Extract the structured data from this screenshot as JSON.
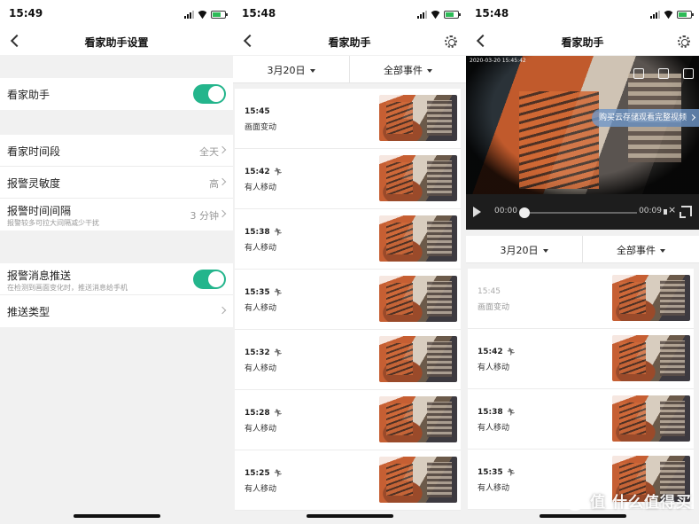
{
  "panels": [
    {
      "status_time": "15:49",
      "title": "看家助手设置"
    },
    {
      "status_time": "15:48",
      "title": "看家助手"
    },
    {
      "status_time": "15:48",
      "title": "看家助手"
    }
  ],
  "settings": {
    "guardian": {
      "label": "看家助手",
      "enabled": true
    },
    "rows": [
      {
        "label": "看家时间段",
        "value": "全天"
      },
      {
        "label": "报警灵敏度",
        "value": "高"
      },
      {
        "label": "报警时间间隔",
        "sub": "报警较多可拉大间隔减少干扰",
        "value": "3 分钟"
      }
    ],
    "push": {
      "label": "报警消息推送",
      "sub": "在检测到画面变化时，推送消息给手机",
      "enabled": true
    },
    "push_type": {
      "label": "推送类型"
    }
  },
  "filters": {
    "date": "3月20日",
    "events": "全部事件"
  },
  "events_list": [
    {
      "time": "15:45",
      "type": "画面变动",
      "person": false
    },
    {
      "time": "15:42",
      "type": "有人移动",
      "person": true
    },
    {
      "time": "15:38",
      "type": "有人移动",
      "person": true
    },
    {
      "time": "15:35",
      "type": "有人移动",
      "person": true
    },
    {
      "time": "15:32",
      "type": "有人移动",
      "person": true
    },
    {
      "time": "15:28",
      "type": "有人移动",
      "person": true
    },
    {
      "time": "15:25",
      "type": "有人移动",
      "person": true
    }
  ],
  "events_list_p3": [
    {
      "time": "15:45",
      "type": "画面变动",
      "person": false,
      "dim": true
    },
    {
      "time": "15:42",
      "type": "有人移动",
      "person": true
    },
    {
      "time": "15:38",
      "type": "有人移动",
      "person": true
    },
    {
      "time": "15:35",
      "type": "有人移动",
      "person": true
    }
  ],
  "video": {
    "timestamp": "2020-03-20 15:45:42",
    "cloud_promo": "购买云存储观看完整视频",
    "time_current": "00:00",
    "time_total": "00:09",
    "progress": 0.0
  },
  "watermark": "值 什么值得买",
  "icons": {
    "back": "chevron-left-icon",
    "settings": "gear-icon",
    "person": "running-person-icon",
    "share": "share-icon",
    "save": "save-icon",
    "delete": "trash-icon",
    "play": "play-icon",
    "mute": "mute-icon",
    "fullscreen": "fullscreen-icon"
  },
  "colors": {
    "accent": "#24b58c",
    "background": "#f1f1f1"
  }
}
